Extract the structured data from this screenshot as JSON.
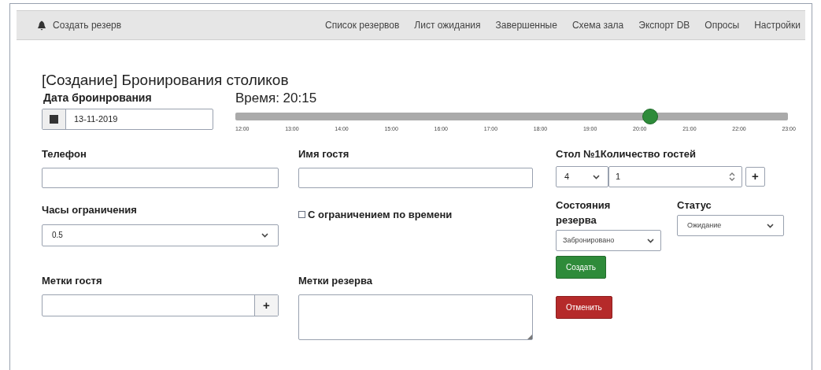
{
  "navbar": {
    "brand": "Создать резерв",
    "links": [
      "Список резервов",
      "Лист ожидания",
      "Завершенные",
      "Схема зала",
      "Экспорт DB",
      "Опросы",
      "Настройки"
    ]
  },
  "title": "[Создание] Бронирования столиков",
  "date": {
    "label": "Дата броинрования",
    "value": "13-11-2019"
  },
  "time": {
    "label": "Время: 20:15",
    "level": 0.75,
    "ticks": [
      "12:00",
      "13:00",
      "14:00",
      "15:00",
      "16:00",
      "17:00",
      "18:00",
      "19:00",
      "20:00",
      "21:00",
      "22:00",
      "23:00"
    ]
  },
  "phone": {
    "label": "Телефон"
  },
  "guest_name": {
    "label": "Имя гостя"
  },
  "table": {
    "label": "Стол №1Количество гостей",
    "table_value": "4",
    "guests_value": "1",
    "add": "+"
  },
  "limit_hours": {
    "label": "Часы ограничения",
    "value": "0.5"
  },
  "time_limit": {
    "label": "С ограничением по времени",
    "checked": false
  },
  "reserve_state": {
    "label": "Состояния резерва",
    "value": "Забронировано"
  },
  "status": {
    "label": "Статус",
    "value": "Ожидание"
  },
  "guest_tags": {
    "label": "Метки гостя",
    "add": "+"
  },
  "reserve_tags": {
    "label": "Метки резерва"
  },
  "buttons": [
    {
      "label": "Создать",
      "kind": "primary"
    },
    {
      "label": "Отменить",
      "kind": "danger"
    }
  ]
}
